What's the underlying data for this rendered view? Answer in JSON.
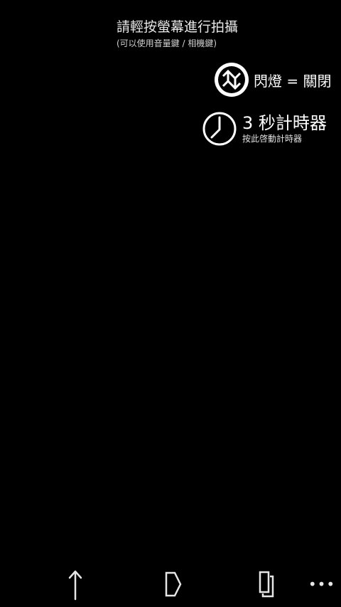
{
  "instruction": {
    "main": "請輕按螢幕進行拍攝",
    "sub": "(可以使用音量鍵 / 相機鍵)"
  },
  "flash": {
    "label": "閃燈 = 關閉",
    "icon": "flash-icon"
  },
  "timer": {
    "label": "3 秒計時器",
    "hint": "按此啓動計時器",
    "icon": "clock-icon"
  },
  "appbar": {
    "buttons": [
      {
        "icon": "upload-arrow-icon"
      },
      {
        "icon": "tag-icon"
      },
      {
        "icon": "copy-pages-icon"
      }
    ],
    "more": "•••"
  },
  "colors": {
    "background": "#000000",
    "foreground": "#ffffff"
  }
}
